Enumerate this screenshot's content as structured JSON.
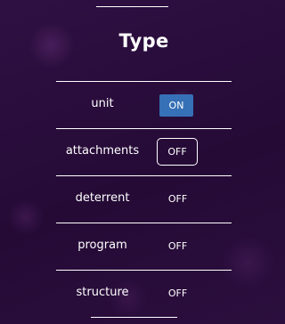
{
  "title": "Type",
  "colors": {
    "background": "#2c0f3e",
    "on_accent": "#3670b6",
    "text": "#ffffff"
  },
  "rows": [
    {
      "label": "unit",
      "state": "ON"
    },
    {
      "label": "attachments",
      "state": "OFF"
    },
    {
      "label": "deterrent",
      "state": "OFF"
    },
    {
      "label": "program",
      "state": "OFF"
    },
    {
      "label": "structure",
      "state": "OFF"
    }
  ]
}
